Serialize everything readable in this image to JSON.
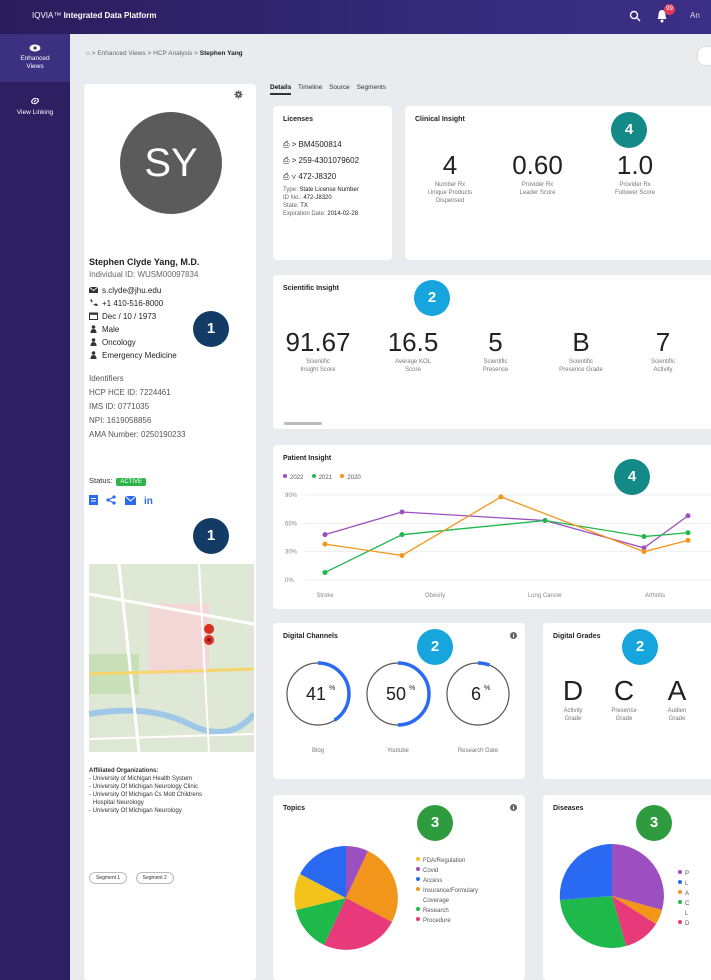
{
  "topbar": {
    "brand": "IQVIA",
    "product": "Integrated Data Platform",
    "notif_count": "99",
    "user": "An"
  },
  "sidebar": {
    "items": [
      {
        "label1": "Enhanced",
        "label2": "Views"
      },
      {
        "label1": "View Linking",
        "label2": ""
      }
    ]
  },
  "breadcrumb": {
    "home": "⌂",
    "crumb1": "Enhanced Views",
    "crumb2": "HCP Analysis",
    "current": "Stephen Yang",
    "sep": ">"
  },
  "profile": {
    "initials": "SY",
    "name": "Stephen Clyde Yang, M.D.",
    "individual_id": "Individual ID: WUSM00097834",
    "email": "s.clyde@jhu.edu",
    "phone": "+1 410-516-8000",
    "dob": "Dec / 10 / 1973",
    "gender": "Male",
    "specialty1": "Oncology",
    "specialty2": "Emergency Medicine",
    "identifiers_label": "Identifiers",
    "hce_label": "HCP HCE ID:",
    "hce": "7224461",
    "ims_label": "IMS ID:",
    "ims": "0771035",
    "npi_label": "NPI:",
    "npi": "1619058856",
    "ama_label": "AMA Number:",
    "ama": "0250190233",
    "status_label": "Status:",
    "status": "ACTIVE",
    "affiliated_title": "Affiliated Organizations:",
    "affiliations": [
      "- University of Michigan Health System",
      "- University Of Michigan Neurology Clinic",
      "- University Of Michigan Cs Mott Childrens",
      "  Hospital Neurology",
      "- University Of Michigan Neurology"
    ],
    "segments": [
      "Segment 1",
      "Segment 2"
    ]
  },
  "tabs": [
    "Details",
    "Timeline",
    "Source",
    "Segments"
  ],
  "callouts": {
    "one": "1",
    "two": "2",
    "three": "3",
    "four": "4"
  },
  "licenses": {
    "title": "Licenses",
    "lines": [
      "> BM4500814",
      "> 259-4301079602",
      "∨ 472-J8320"
    ],
    "type_label": "Type:",
    "type": "State License Number",
    "id_label": "ID No.:",
    "id": "472-J8320",
    "state_label": "State:",
    "state": "TX",
    "exp_label": "Expiration Date:",
    "exp": "2014-02-28"
  },
  "clinical": {
    "title": "Clinical Insight",
    "metrics": [
      {
        "value": "4",
        "label1": "Number Rx",
        "label2": "Unique Products",
        "label3": "Dispensed"
      },
      {
        "value": "0.60",
        "label1": "Provider Rx",
        "label2": "Leader Score",
        "label3": ""
      },
      {
        "value": "1.0",
        "label1": "Provider Rx",
        "label2": "Follower Score",
        "label3": ""
      }
    ]
  },
  "scientific": {
    "title": "Scientific Insight",
    "metrics": [
      {
        "value": "91.67",
        "label1": "Scientific",
        "label2": "Insight Score"
      },
      {
        "value": "16.5",
        "label1": "Average KOL",
        "label2": "Score"
      },
      {
        "value": "5",
        "label1": "Scientific",
        "label2": "Presence"
      },
      {
        "value": "B",
        "label1": "Scientific",
        "label2": "Presence Grade"
      },
      {
        "value": "7",
        "label1": "Scientific",
        "label2": "Activity"
      }
    ]
  },
  "patient": {
    "title": "Patient Insight",
    "legend": [
      "2022",
      "2021",
      "2020"
    ],
    "colors": [
      "#9b4fc0",
      "#1fb84a",
      "#f2961b"
    ]
  },
  "chart_data": {
    "type": "line",
    "categories": [
      "Stroke",
      "Obesity",
      "Lung Cancer",
      "Arthritis",
      ""
    ],
    "y_ticks": [
      "0%",
      "30%",
      "60%",
      "90%"
    ],
    "ylim": [
      0,
      90
    ],
    "series": [
      {
        "name": "2022",
        "points": [
          [
            0,
            48
          ],
          [
            0.7,
            72
          ],
          [
            2,
            63
          ],
          [
            2.9,
            34
          ],
          [
            3.3,
            68
          ]
        ]
      },
      {
        "name": "2021",
        "points": [
          [
            0,
            8
          ],
          [
            0.7,
            48
          ],
          [
            2,
            63
          ],
          [
            2.9,
            46
          ],
          [
            3.3,
            50
          ]
        ]
      },
      {
        "name": "2020",
        "points": [
          [
            0,
            38
          ],
          [
            0.7,
            26
          ],
          [
            1.6,
            88
          ],
          [
            2.9,
            30
          ],
          [
            3.3,
            42
          ]
        ]
      }
    ]
  },
  "digital_channels": {
    "title": "Digital Channels",
    "items": [
      {
        "value": "41",
        "unit": "%",
        "label": "Blog",
        "pct": 0.41
      },
      {
        "value": "50",
        "unit": "%",
        "label": "Youtube",
        "pct": 0.5
      },
      {
        "value": "6",
        "unit": "%",
        "label": "Research Gate",
        "pct": 0.06
      }
    ]
  },
  "digital_grades": {
    "title": "Digital Grades",
    "items": [
      {
        "grade": "D",
        "label1": "Activity",
        "label2": "Grade"
      },
      {
        "grade": "C",
        "label1": "Presence",
        "label2": "Grade"
      },
      {
        "grade": "A",
        "label1": "Audien",
        "label2": "Grade"
      }
    ]
  },
  "topics": {
    "title": "Topics",
    "legend": [
      {
        "label": "FDA/Regulation",
        "color": "#f2c31b"
      },
      {
        "label": "Covid",
        "color": "#9b4fc0"
      },
      {
        "label": "Access",
        "color": "#2a6af2"
      },
      {
        "label": "Insurance/Formulary",
        "color": "#f2961b"
      },
      {
        "label": "Coverage",
        "color": ""
      },
      {
        "label": "Research",
        "color": "#1fb84a"
      },
      {
        "label": "Procedure",
        "color": "#e83a7a"
      }
    ]
  },
  "diseases": {
    "title": "Diseases",
    "legend": [
      {
        "label": "P",
        "color": "#9b4fc0"
      },
      {
        "label": "L",
        "color": "#2a6af2"
      },
      {
        "label": "A",
        "color": "#f2961b"
      },
      {
        "label": "C",
        "color": "#1fb84a"
      },
      {
        "label": "L",
        "color": ""
      },
      {
        "label": "D",
        "color": "#e83a7a"
      }
    ]
  }
}
